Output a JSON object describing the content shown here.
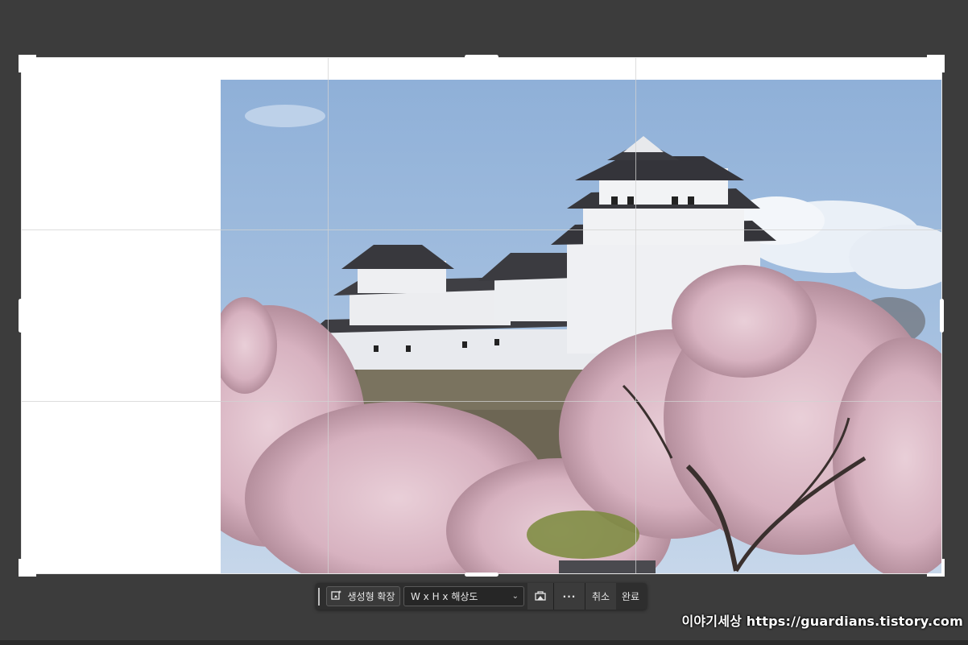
{
  "contextual_taskbar": {
    "generative_expand_label": "생성형 확장",
    "ratio_select_value": "W x H x 해상도",
    "more_label": "···",
    "cancel_label": "취소",
    "done_label": "완료"
  },
  "icons": {
    "generative_expand": "generative-expand-icon",
    "clear_ratio": "clear-icon",
    "chevron": "chevron-down-icon"
  },
  "watermark": {
    "text": "이야기세상 https://guardians.tistory.com"
  },
  "colors": {
    "workspace_bg": "#3c3c3c",
    "canvas_bg": "#ffffff",
    "taskbar_bg": "#2e2e2e"
  }
}
